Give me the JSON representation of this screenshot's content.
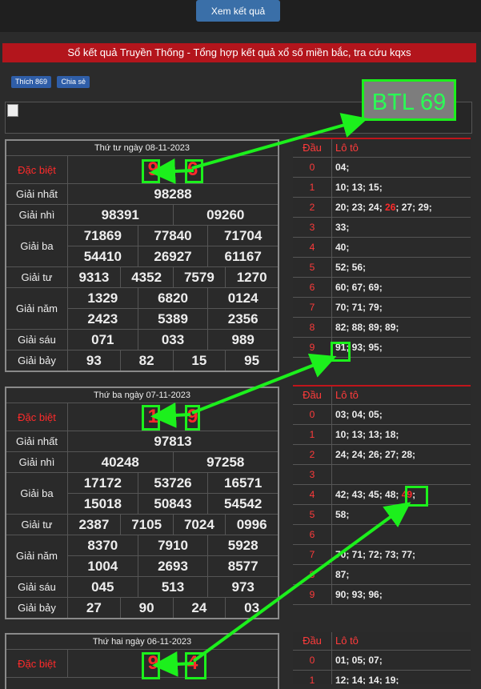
{
  "topbar": {
    "button_label": "Xem kết quả"
  },
  "banner": {
    "text": "Sổ kết quả Truyền Thống - Tổng hợp kết quả xổ số miền bắc, tra cứu kqxs"
  },
  "social": {
    "like": "Thích 869",
    "share": "Chia sẻ"
  },
  "overlay": {
    "btl": "BTL 69",
    "color": "#1cf01c"
  },
  "days": [
    {
      "title": "Thứ tư ngày 08-11-2023",
      "labels": [
        "Đặc biệt",
        "Giải nhất",
        "Giải nhì",
        "Giải ba",
        "Giải tư",
        "Giải năm",
        "Giải sáu",
        "Giải bảy"
      ],
      "db_left": "9",
      "db_right": "6",
      "g1": "98288",
      "g2": [
        "98391",
        "09260"
      ],
      "g3": [
        "71869",
        "77840",
        "71704",
        "54410",
        "26927",
        "61167"
      ],
      "g4": [
        "9313",
        "4352",
        "7579",
        "1270"
      ],
      "g5": [
        "1329",
        "6820",
        "0124",
        "2423",
        "5389",
        "2356"
      ],
      "g6": [
        "071",
        "033",
        "989"
      ],
      "g7": [
        "93",
        "82",
        "15",
        "95"
      ]
    },
    {
      "title": "Thứ ba ngày 07-11-2023",
      "labels": [
        "Đặc biệt",
        "Giải nhất",
        "Giải nhì",
        "Giải ba",
        "Giải tư",
        "Giải năm",
        "Giải sáu",
        "Giải bảy"
      ],
      "db_left": "1",
      "db_right": "9",
      "g1": "97813",
      "g2": [
        "40248",
        "97258"
      ],
      "g3": [
        "17172",
        "53726",
        "16571",
        "15018",
        "50843",
        "54542"
      ],
      "g4": [
        "2387",
        "7105",
        "7024",
        "0996"
      ],
      "g5": [
        "8370",
        "7910",
        "5928",
        "1004",
        "2693",
        "8577"
      ],
      "g6": [
        "045",
        "513",
        "973"
      ],
      "g7": [
        "27",
        "90",
        "24",
        "03"
      ]
    },
    {
      "title": "Thứ hai ngày 06-11-2023",
      "labels": [
        "Đặc biệt"
      ],
      "db_left": "9",
      "db_right": "4"
    }
  ],
  "loto_header": {
    "dau": "Đầu",
    "loto": "Lô tô"
  },
  "loto": [
    {
      "rows": [
        {
          "d": "0",
          "v": "04;"
        },
        {
          "d": "1",
          "v": "10; 13; 15;"
        },
        {
          "d": "2",
          "v": "20; 23; 24;",
          "hl": "26",
          "v2": "; 27; 29;"
        },
        {
          "d": "3",
          "v": "33;"
        },
        {
          "d": "4",
          "v": "40;"
        },
        {
          "d": "5",
          "v": "52; 56;"
        },
        {
          "d": "6",
          "v": "60; 67; 69;"
        },
        {
          "d": "7",
          "v": "70; 71; 79;"
        },
        {
          "d": "8",
          "v": "82; 88; 89; 89;"
        },
        {
          "d": "9",
          "v": "91; 93; 95;"
        }
      ]
    },
    {
      "rows": [
        {
          "d": "0",
          "v": "03; 04; 05;"
        },
        {
          "d": "1",
          "v": "10; 13; 13; 18;"
        },
        {
          "d": "2",
          "v": "24; 24; 26; 27; 28;"
        },
        {
          "d": "3",
          "v": ""
        },
        {
          "d": "4",
          "v": "42; 43; 45; 48;",
          "hl": "49",
          "v2": ";"
        },
        {
          "d": "5",
          "v": "58;"
        },
        {
          "d": "6",
          "v": ""
        },
        {
          "d": "7",
          "v": "70; 71; 72; 73; 77;"
        },
        {
          "d": "8",
          "v": "87;"
        },
        {
          "d": "9",
          "v": "90; 93; 96;"
        }
      ]
    },
    {
      "rows": [
        {
          "d": "0",
          "v": "01; 05; 07;"
        },
        {
          "d": "1",
          "v": "12; 14; 14; 19;"
        }
      ]
    }
  ]
}
